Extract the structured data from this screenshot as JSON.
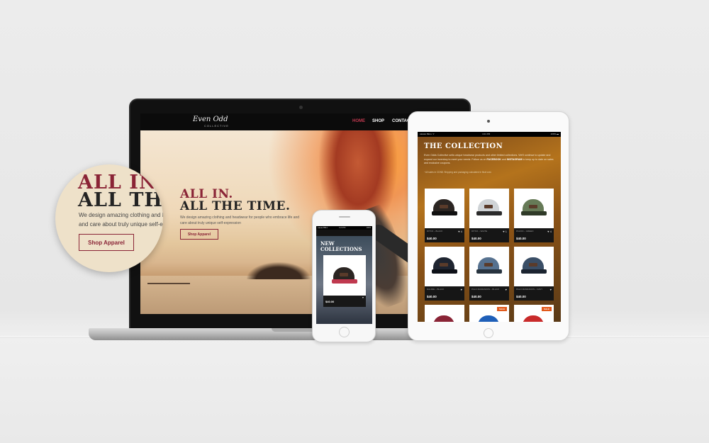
{
  "laptop": {
    "logo": "Even Odd",
    "logo_sub": "COLLECTIVE",
    "nav": [
      "HOME",
      "SHOP",
      "CONTACT"
    ],
    "hero": {
      "title_line1": "ALL IN.",
      "title_line2": "ALL THE TIME.",
      "text": "We design amazing clothing and headwear for people who embrace life and care about truly unique self-expression",
      "button": "Shop Apparel"
    }
  },
  "zoom": {
    "title_line1": "ALL IN.",
    "title_line2": "ALL THE",
    "text_line1": "We design amazing clothing and he",
    "text_line2": "and care about truly unique self-exp",
    "button": "Shop Apparel"
  },
  "tablet": {
    "status_left": "●●●●● BELL ᯤ",
    "status_time": "4:21 PM",
    "status_right": "100% ▬",
    "title": "THE COLLECTION",
    "desc_1": "Even Odds Collective sells unique headwear products and other limited collections. We'll continue to update and expand our inventory to meet your needs. Follow us on",
    "desc_facebook": "FACEBOOK",
    "desc_2": "and",
    "desc_instagram": "INSTAGRAM",
    "desc_3": "to keep up to date on sales and exclusive coupons.",
    "note": "~All sales in CDN$. Shipping and packaging calculated in final cost.",
    "products": [
      {
        "name": "DITKO – BLACK",
        "price": "$40.00",
        "likes": "4"
      },
      {
        "name": "DITKO – WHITE",
        "price": "$40.00",
        "likes": "1"
      },
      {
        "name": "PALKIN – GREEN",
        "price": "$40.00",
        "likes": "4"
      },
      {
        "name": "DALMIE – BLACK",
        "price": "$40.00",
        "likes": ""
      },
      {
        "name": "PALO MANRADOS – BLACK",
        "price": "$40.00",
        "likes": ""
      },
      {
        "name": "PALO MANRADOS – NAVY",
        "price": "$40.00",
        "likes": ""
      }
    ],
    "sale_label": "SALE"
  },
  "phone": {
    "status_left": "●●●●● BELL",
    "status_time": "4:21 PM",
    "status_right": "100%",
    "title": "NEW COLLECTIONS",
    "price": "$40.00"
  },
  "colors": {
    "brand_red": "#8a2436",
    "sale_orange": "#e25a1c"
  }
}
